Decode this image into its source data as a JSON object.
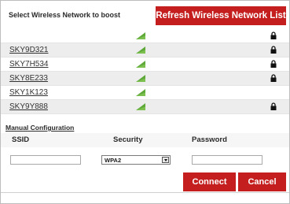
{
  "header": {
    "prompt": "Select Wireless Network to boost",
    "refresh_label": "Refresh Wireless Network List"
  },
  "networks": [
    {
      "ssid": "",
      "secured": true,
      "signal_icon": "signal-icon",
      "lock_icon": "lock-icon"
    },
    {
      "ssid": "SKY9D321",
      "secured": true,
      "signal_icon": "signal-icon",
      "lock_icon": "lock-icon"
    },
    {
      "ssid": "SKY7H534",
      "secured": true,
      "signal_icon": "signal-icon",
      "lock_icon": "lock-icon"
    },
    {
      "ssid": "SKY8E233",
      "secured": true,
      "signal_icon": "signal-icon",
      "lock_icon": "lock-icon"
    },
    {
      "ssid": "SKY1K123",
      "secured": false,
      "signal_icon": "signal-icon"
    },
    {
      "ssid": "SKY9Y888",
      "secured": true,
      "signal_icon": "signal-icon",
      "lock_icon": "lock-icon"
    }
  ],
  "manual": {
    "title": "Manual Configuration",
    "ssid_label": "SSID",
    "security_label": "Security",
    "password_label": "Password",
    "ssid_value": "",
    "security_selected": "WPA2",
    "password_value": ""
  },
  "actions": {
    "connect_label": "Connect",
    "cancel_label": "Cancel"
  },
  "colors": {
    "accent": "#c41e1e",
    "signal": "#5fa83a",
    "row_shade": "#ededed"
  }
}
